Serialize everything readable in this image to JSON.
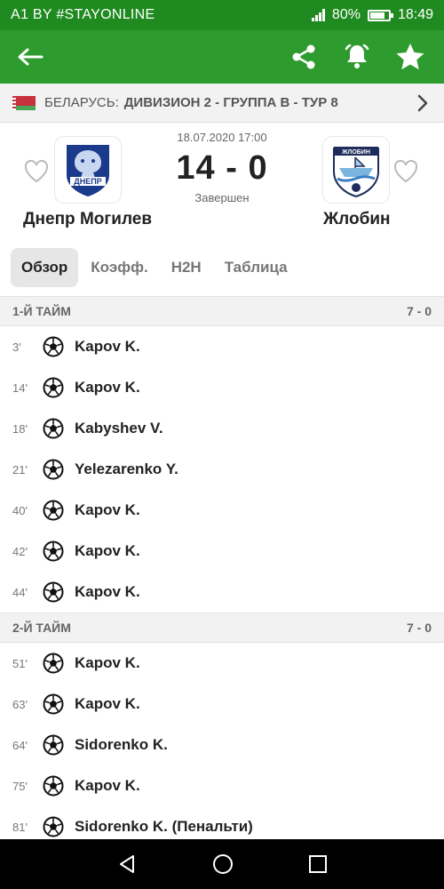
{
  "status_bar": {
    "carrier": "A1 BY #STAYONLINE",
    "battery": "80%",
    "battery_level": 0.8,
    "time": "18:49"
  },
  "app_bar": {
    "icons": [
      "arrow-left-icon",
      "share-icon",
      "bell-icon",
      "star-icon"
    ]
  },
  "league": {
    "country": "БЕЛАРУСЬ:",
    "competition": "ДИВИЗИОН 2 - ГРУППА В - ТУР 8"
  },
  "match": {
    "date": "18.07.2020 17:00",
    "score": "14 - 0",
    "status": "Завершен",
    "home": {
      "name": "Днепр Могилев",
      "logo_text": "ДНЕПР"
    },
    "away": {
      "name": "Жлобин",
      "logo_text": "ЖЛОБИН"
    }
  },
  "tabs": [
    {
      "label": "Обзор",
      "active": true
    },
    {
      "label": "Коэфф.",
      "active": false
    },
    {
      "label": "H2H",
      "active": false
    },
    {
      "label": "Таблица",
      "active": false
    }
  ],
  "halves": [
    {
      "label": "1-Й ТАЙМ",
      "score": "7 - 0",
      "events": [
        {
          "minute": "3'",
          "player": "Kapov K."
        },
        {
          "minute": "14'",
          "player": "Kapov K."
        },
        {
          "minute": "18'",
          "player": "Kabyshev V."
        },
        {
          "minute": "21'",
          "player": "Yelezarenko Y."
        },
        {
          "minute": "40'",
          "player": "Kapov K."
        },
        {
          "minute": "42'",
          "player": "Kapov K."
        },
        {
          "minute": "44'",
          "player": "Kapov K."
        }
      ]
    },
    {
      "label": "2-Й ТАЙМ",
      "score": "7 - 0",
      "events": [
        {
          "minute": "51'",
          "player": "Kapov K."
        },
        {
          "minute": "63'",
          "player": "Kapov K."
        },
        {
          "minute": "64'",
          "player": "Sidorenko K."
        },
        {
          "minute": "75'",
          "player": "Kapov K."
        },
        {
          "minute": "81'",
          "player": "Sidorenko K. (Пенальти)"
        }
      ]
    }
  ],
  "colors": {
    "status_bar": "#1f8a1f",
    "app_bar": "#2e9b2e"
  }
}
